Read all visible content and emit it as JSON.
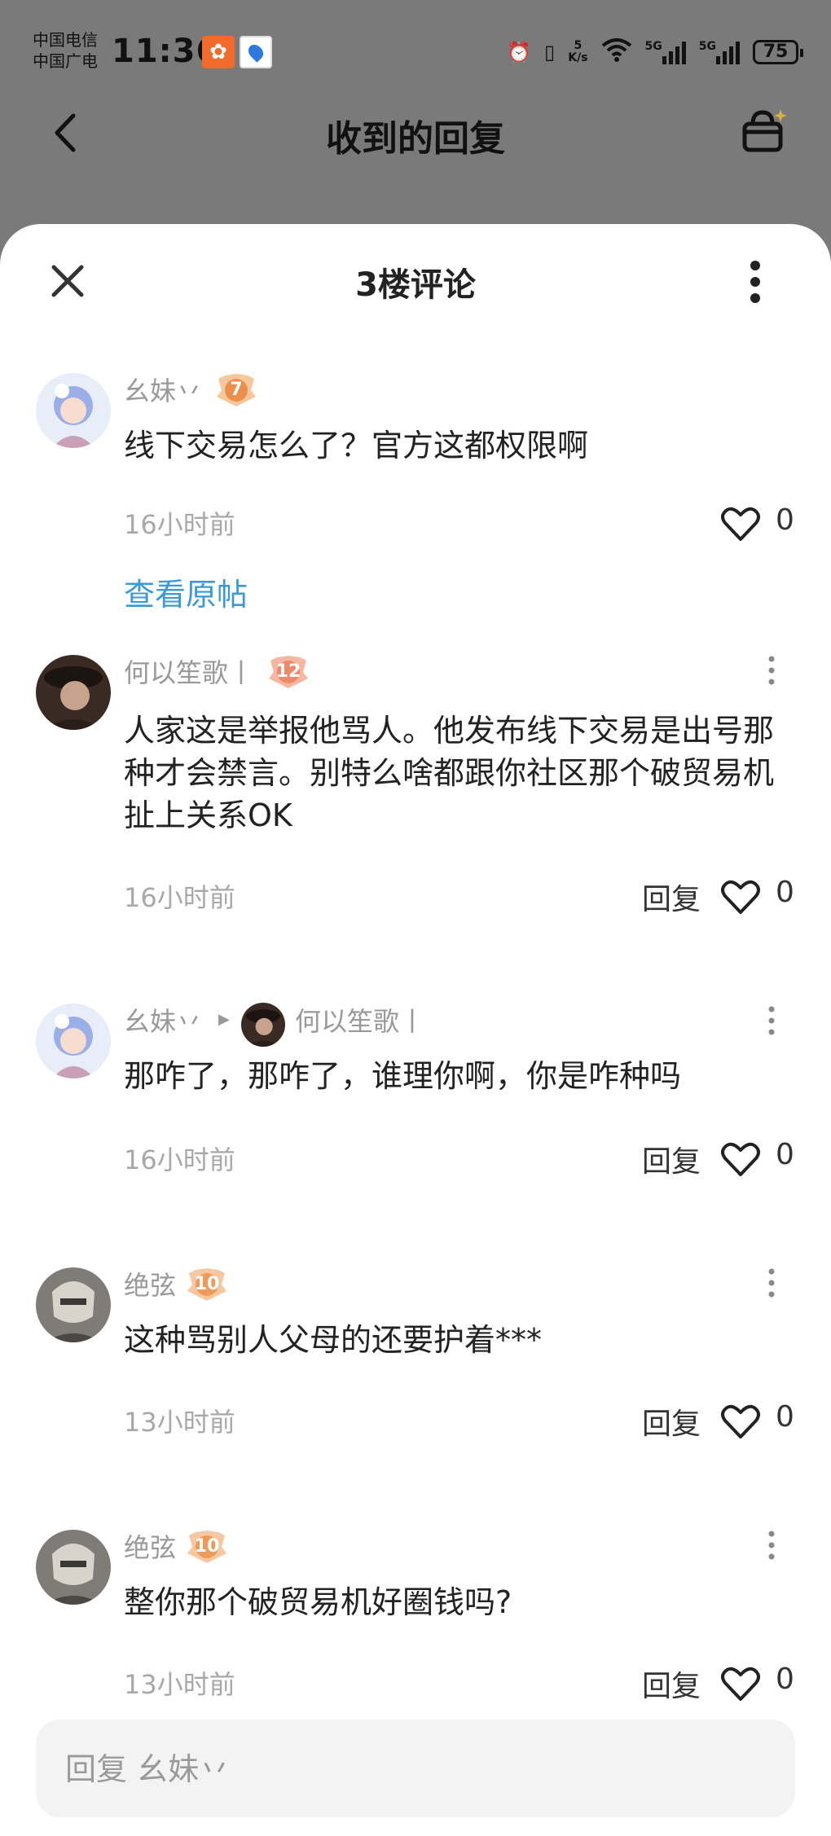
{
  "status_bar": {
    "carrier_1": "中国电信",
    "carrier_2": "中国广电",
    "time": "11:36",
    "net_speed_value": "5",
    "net_speed_unit": "K/s",
    "signal_1": "5G",
    "signal_2": "5G",
    "battery": "75"
  },
  "header": {
    "title": "收到的回复"
  },
  "sheet": {
    "title": "3楼评论",
    "original_comment": {
      "username": "幺妹丷",
      "badge_level": "7",
      "text": "线下交易怎么了？官方这都权限啊",
      "time": "16小时前",
      "likes": "0",
      "view_post": "查看原帖"
    },
    "replies": [
      {
        "username": "何以笙歌丨",
        "badge_level": "12",
        "text": "人家这是举报他骂人。他发布线下交易是出号那种才会禁言。别特么啥都跟你社区那个破贸易机扯上关系OK",
        "time": "16小时前",
        "reply_label": "回复",
        "likes": "0"
      },
      {
        "username": "幺妹丷",
        "reply_to": "何以笙歌丨",
        "text": "那咋了，那咋了，谁理你啊，你是咋种吗",
        "time": "16小时前",
        "reply_label": "回复",
        "likes": "0"
      },
      {
        "username": "绝弦",
        "badge_level": "10",
        "text": "这种骂别人父母的还要护着***",
        "time": "13小时前",
        "reply_label": "回复",
        "likes": "0"
      },
      {
        "username": "绝弦",
        "badge_level": "10",
        "text": "整你那个破贸易机好圈钱吗?",
        "time": "13小时前",
        "reply_label": "回复",
        "likes": "0"
      }
    ],
    "reply_input": {
      "placeholder": "回复 幺妹丷"
    }
  },
  "colors": {
    "link": "#3a9ad9",
    "badge_orange": "#f0a36a",
    "dim_overlay": "#7a7a7a"
  }
}
